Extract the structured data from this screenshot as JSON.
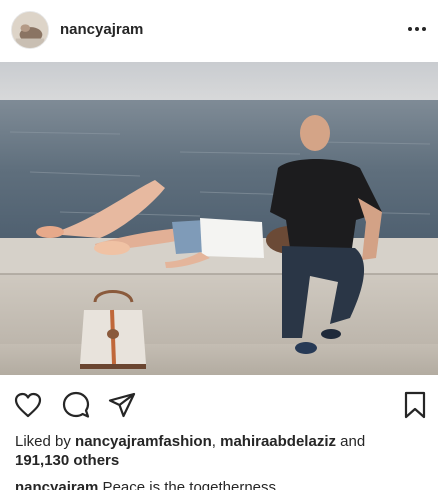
{
  "post": {
    "username": "nancyajram",
    "more_icon": "more-horizontal-icon",
    "likes": {
      "prefix": "Liked by ",
      "user1": "nancyajramfashion",
      "separator": ", ",
      "user2": "mahiraabdelaziz",
      "and": " and",
      "count_text": "191,130 others"
    },
    "caption": {
      "username": "nancyajram",
      "text": " Peace is the togetherness"
    },
    "icons": {
      "like": "heart-icon",
      "comment": "comment-icon",
      "share": "send-icon",
      "save": "bookmark-icon"
    }
  }
}
